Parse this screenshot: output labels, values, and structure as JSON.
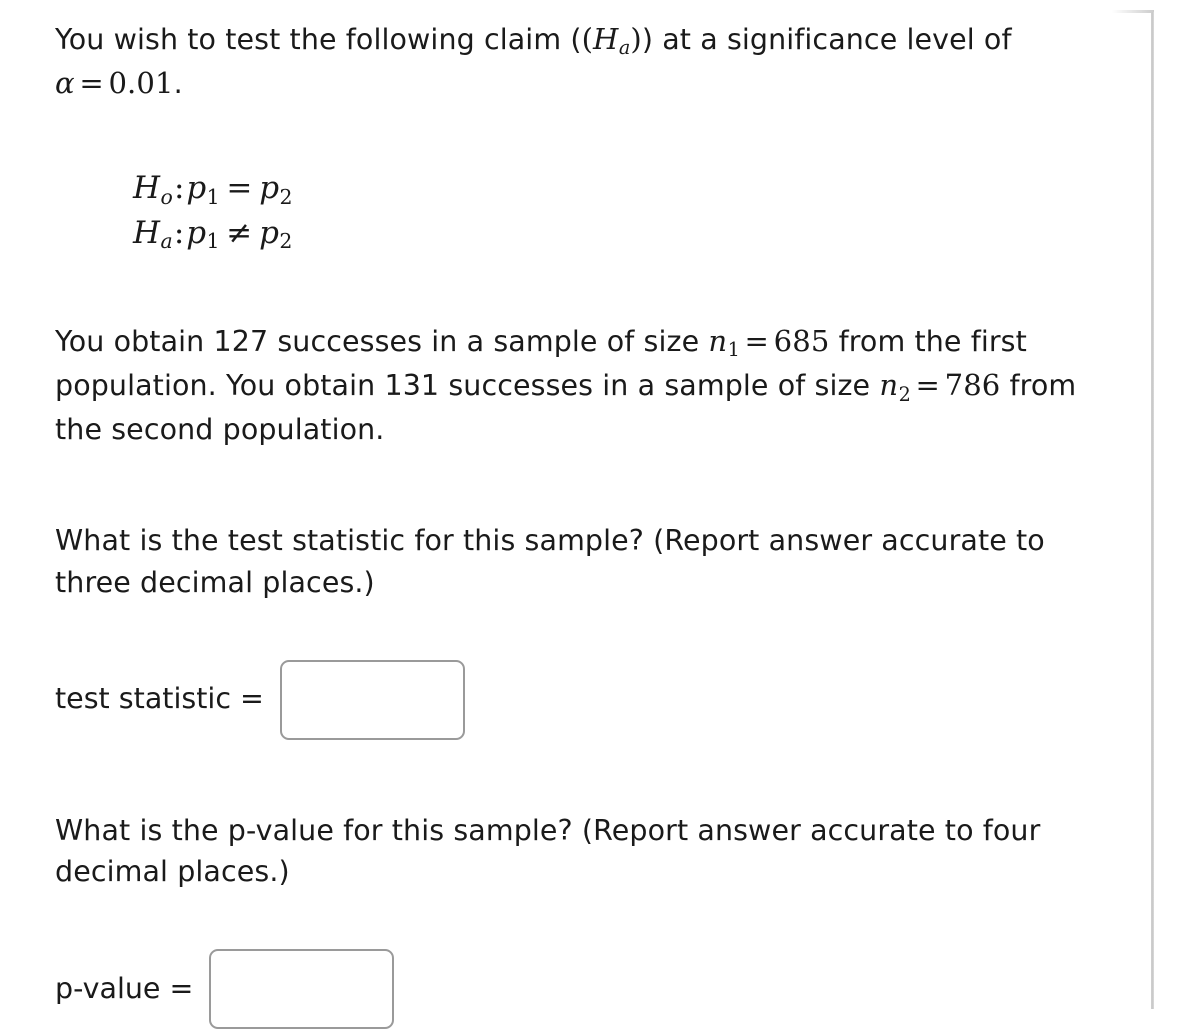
{
  "problem": {
    "intro": {
      "text_before_math": "You wish to test the following claim (",
      "claim_symbol_H": "H",
      "claim_symbol_sub": "a",
      "text_after_math": ") at a significance level of ",
      "alpha_symbol": "α",
      "equals": "=",
      "alpha_value": "0.01",
      "period": "."
    },
    "hypotheses": {
      "null": {
        "symbol": "H",
        "subscript": "o",
        "colon": ":",
        "lhs": "p",
        "lhs_sub": "1",
        "relation": "=",
        "rhs": "p",
        "rhs_sub": "2"
      },
      "alternative": {
        "symbol": "H",
        "subscript": "a",
        "colon": ":",
        "lhs": "p",
        "lhs_sub": "1",
        "relation": "≠",
        "rhs": "p",
        "rhs_sub": "2"
      }
    },
    "sample_data": {
      "seg1": "You obtain ",
      "successes_1": "127",
      "seg2": " successes in a sample of size ",
      "n1_symbol": "n",
      "n1_sub": "1",
      "n1_equals": "=",
      "n1_value": "685",
      "seg3": " from the first population. You obtain ",
      "successes_2": "131",
      "seg4": " successes in a sample of size ",
      "n2_symbol": "n",
      "n2_sub": "2",
      "n2_equals": "=",
      "n2_value": "786",
      "seg5": " from the second population."
    },
    "test_statistic_question": "What is the test statistic for this sample? (Report answer accurate to three decimal places.)",
    "p_value_question": "What is the p-value for this sample? (Report answer accurate to four decimal places.)"
  },
  "answers": {
    "test_statistic": {
      "label": "test statistic =",
      "value": "",
      "placeholder": ""
    },
    "p_value": {
      "label": "p-value =",
      "value": "",
      "placeholder": ""
    }
  },
  "colors": {
    "text": "#1a1a1a",
    "input_border": "#9a9a9a",
    "panel_edge": "#c8c8c8",
    "background": "#ffffff"
  }
}
